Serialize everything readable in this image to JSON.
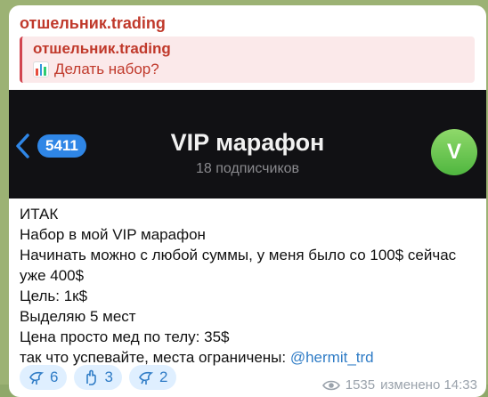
{
  "message": {
    "sender": "отшельник.trading",
    "reply": {
      "name": "отшельник.trading",
      "text": "Делать набор?",
      "icon": "bar-chart-icon"
    },
    "screenshot": {
      "back_count": "5411",
      "title": "VIP марафон",
      "subtitle": "18 подписчиков",
      "avatar_letter": "V"
    },
    "lines": [
      "ИТАК",
      "Набор в мой VIP марафон",
      "Начинать можно с любой суммы, у меня было со 100$ сейчас уже 400$",
      "Цель: 1к$",
      "Выделяю 5 мест",
      "Цена просто мед по телу: 35$"
    ],
    "last_line_text": "так что успевайте, места ограничены: ",
    "mention": "@hermit_trd",
    "reactions": [
      {
        "icon": "dove-icon",
        "count": "6"
      },
      {
        "icon": "hand-icon",
        "count": "3"
      },
      {
        "icon": "dove-icon",
        "count": "2"
      }
    ],
    "views": "1535",
    "edited_time": "изменено 14:33"
  },
  "colors": {
    "accent": "#c0392b",
    "link": "#2f7cc6",
    "pill": "#2f86e6",
    "avatar": "#5cc14a"
  }
}
